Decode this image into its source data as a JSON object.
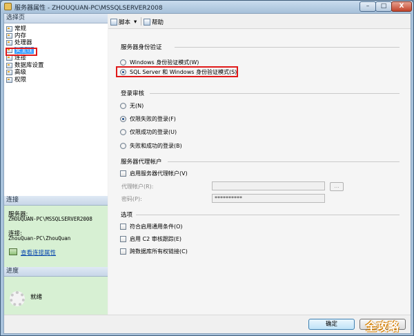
{
  "window": {
    "title": "服务器属性 - ZHOUQUAN-PC\\MSSQLSERVER2008",
    "minimize": "–",
    "maximize": "□",
    "close": "X"
  },
  "left": {
    "select_page_header": "选择页",
    "pages": [
      {
        "label": "常规"
      },
      {
        "label": "内存"
      },
      {
        "label": "处理器"
      },
      {
        "label": "安全性"
      },
      {
        "label": "连接"
      },
      {
        "label": "数据库设置"
      },
      {
        "label": "高级"
      },
      {
        "label": "权限"
      }
    ],
    "connection_header": "连接",
    "server_label": "服务器:",
    "server_value": "ZHOUQUAN-PC\\MSSQLSERVER2008",
    "connection_label": "连接:",
    "connection_value": "ZhouQuan-PC\\ZhouQuan",
    "view_link": "查看连接属性",
    "progress_header": "进度",
    "progress_status": "就绪"
  },
  "toolbar": {
    "script_label": "脚本",
    "script_arrow": "▾",
    "help_label": "帮助"
  },
  "auth": {
    "title": "服务器身份验证",
    "windows_mode": "Windows 身份验证模式(W)",
    "mixed_mode": "SQL Server 和 Windows 身份验证模式(S)",
    "selected": "mixed"
  },
  "audit": {
    "title": "登录审核",
    "options": [
      "无(N)",
      "仅限失败的登录(F)",
      "仅限成功的登录(U)",
      "失败和成功的登录(B)"
    ],
    "selected_index": 1
  },
  "proxy": {
    "title": "服务器代理帐户",
    "enable_label": "启用服务器代理帐户(V)",
    "account_label": "代理帐户(R):",
    "account_value": "",
    "password_label": "密码(P):",
    "password_value": "**********",
    "browse": "..."
  },
  "options": {
    "title": "选项",
    "items": [
      "符合启用通用条件(O)",
      "启用 C2 审核跟踪(E)",
      "跨数据库所有权链接(C)"
    ]
  },
  "buttons": {
    "ok": "确定",
    "cancel": ""
  },
  "watermark": "全攻略"
}
